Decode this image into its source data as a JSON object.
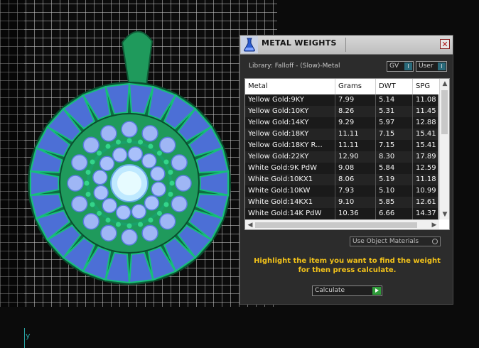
{
  "viewport": {
    "axis_label": "y"
  },
  "panel": {
    "title": "METAL WEIGHTS",
    "close_label": "✕",
    "library_label": "Library: Falloff - (Slow)-Metal",
    "gv_label": "GV",
    "user_label": "User",
    "toggle_mark": "I",
    "columns": [
      "Metal",
      "Grams",
      "DWT",
      "SPG"
    ],
    "rows": [
      {
        "metal": "Yellow Gold:9KY",
        "grams": "7.99",
        "dwt": "5.14",
        "spg": "11.08"
      },
      {
        "metal": "Yellow Gold:10KY",
        "grams": "8.26",
        "dwt": "5.31",
        "spg": "11.45"
      },
      {
        "metal": "Yellow Gold:14KY",
        "grams": "9.29",
        "dwt": "5.97",
        "spg": "12.88"
      },
      {
        "metal": "Yellow Gold:18KY",
        "grams": "11.11",
        "dwt": "7.15",
        "spg": "15.41"
      },
      {
        "metal": "Yellow Gold:18KY R...",
        "grams": "11.11",
        "dwt": "7.15",
        "spg": "15.41"
      },
      {
        "metal": "Yellow Gold:22KY",
        "grams": "12.90",
        "dwt": "8.30",
        "spg": "17.89"
      },
      {
        "metal": "White Gold:9K PdW",
        "grams": "9.08",
        "dwt": "5.84",
        "spg": "12.59"
      },
      {
        "metal": "White Gold:10KX1",
        "grams": "8.06",
        "dwt": "5.19",
        "spg": "11.18"
      },
      {
        "metal": "White Gold:10KW",
        "grams": "7.93",
        "dwt": "5.10",
        "spg": "10.99"
      },
      {
        "metal": "White Gold:14KX1",
        "grams": "9.10",
        "dwt": "5.85",
        "spg": "12.61"
      },
      {
        "metal": "White Gold:14K PdW",
        "grams": "10.36",
        "dwt": "6.66",
        "spg": "14.37"
      }
    ],
    "use_object_materials_label": "Use Object Materials",
    "hint": "Highlight the item you want to find the weight for then press calculate.",
    "calculate_label": "Calculate",
    "colors": {
      "panel_bg": "#2c2c2c",
      "hint": "#f2c21a",
      "row_bg": "#1a1a1a",
      "pendant_metal": "#1f9a5c",
      "pendant_stone": "#4c6fd6"
    }
  }
}
